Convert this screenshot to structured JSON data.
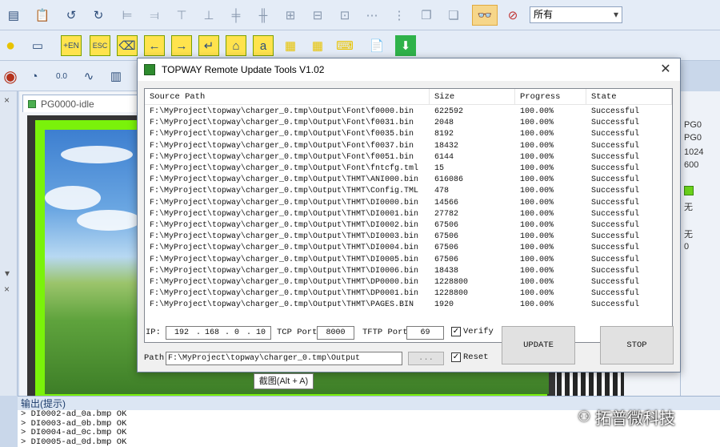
{
  "toolbar3": {
    "preset_label": "所有"
  },
  "doc": {
    "tab_title": "PG0000-idle"
  },
  "properties": [
    "PG0",
    "PG0",
    "1024",
    "600",
    "无",
    "无",
    "0"
  ],
  "dialog": {
    "title": "TOPWAY Remote Update Tools V1.02",
    "columns": [
      "Source Path",
      "Size",
      "Progress",
      "State"
    ],
    "rows": [
      {
        "path": "F:\\MyProject\\topway\\charger_0.tmp\\Output\\Font\\f0000.bin",
        "size": "622592",
        "progress": "100.00%",
        "state": "Successful"
      },
      {
        "path": "F:\\MyProject\\topway\\charger_0.tmp\\Output\\Font\\f0031.bin",
        "size": "2048",
        "progress": "100.00%",
        "state": "Successful"
      },
      {
        "path": "F:\\MyProject\\topway\\charger_0.tmp\\Output\\Font\\f0035.bin",
        "size": "8192",
        "progress": "100.00%",
        "state": "Successful"
      },
      {
        "path": "F:\\MyProject\\topway\\charger_0.tmp\\Output\\Font\\f0037.bin",
        "size": "18432",
        "progress": "100.00%",
        "state": "Successful"
      },
      {
        "path": "F:\\MyProject\\topway\\charger_0.tmp\\Output\\Font\\f0051.bin",
        "size": "6144",
        "progress": "100.00%",
        "state": "Successful"
      },
      {
        "path": "F:\\MyProject\\topway\\charger_0.tmp\\Output\\Font\\fntcfg.tml",
        "size": "15",
        "progress": "100.00%",
        "state": "Successful"
      },
      {
        "path": "F:\\MyProject\\topway\\charger_0.tmp\\Output\\THMT\\ANI000.bin",
        "size": "616086",
        "progress": "100.00%",
        "state": "Successful"
      },
      {
        "path": "F:\\MyProject\\topway\\charger_0.tmp\\Output\\THMT\\Config.TML",
        "size": "478",
        "progress": "100.00%",
        "state": "Successful"
      },
      {
        "path": "F:\\MyProject\\topway\\charger_0.tmp\\Output\\THMT\\DI0000.bin",
        "size": "14566",
        "progress": "100.00%",
        "state": "Successful"
      },
      {
        "path": "F:\\MyProject\\topway\\charger_0.tmp\\Output\\THMT\\DI0001.bin",
        "size": "27782",
        "progress": "100.00%",
        "state": "Successful"
      },
      {
        "path": "F:\\MyProject\\topway\\charger_0.tmp\\Output\\THMT\\DI0002.bin",
        "size": "67506",
        "progress": "100.00%",
        "state": "Successful"
      },
      {
        "path": "F:\\MyProject\\topway\\charger_0.tmp\\Output\\THMT\\DI0003.bin",
        "size": "67506",
        "progress": "100.00%",
        "state": "Successful"
      },
      {
        "path": "F:\\MyProject\\topway\\charger_0.tmp\\Output\\THMT\\DI0004.bin",
        "size": "67506",
        "progress": "100.00%",
        "state": "Successful"
      },
      {
        "path": "F:\\MyProject\\topway\\charger_0.tmp\\Output\\THMT\\DI0005.bin",
        "size": "67506",
        "progress": "100.00%",
        "state": "Successful"
      },
      {
        "path": "F:\\MyProject\\topway\\charger_0.tmp\\Output\\THMT\\DI0006.bin",
        "size": "18438",
        "progress": "100.00%",
        "state": "Successful"
      },
      {
        "path": "F:\\MyProject\\topway\\charger_0.tmp\\Output\\THMT\\DP0000.bin",
        "size": "1228800",
        "progress": "100.00%",
        "state": "Successful"
      },
      {
        "path": "F:\\MyProject\\topway\\charger_0.tmp\\Output\\THMT\\DP0001.bin",
        "size": "1228800",
        "progress": "100.00%",
        "state": "Successful"
      },
      {
        "path": "F:\\MyProject\\topway\\charger_0.tmp\\Output\\THMT\\PAGES.BIN",
        "size": "1920",
        "progress": "100.00%",
        "state": "Successful"
      }
    ],
    "ip_label": "IP:",
    "ip": [
      "192",
      "168",
      "0",
      "10"
    ],
    "tcp_label": "TCP Port:",
    "tcp_port": "8000",
    "tftp_label": "TFTP Port:",
    "tftp_port": "69",
    "verify_label": "Verify",
    "reset_label": "Reset",
    "path_label": "Path:",
    "path_value": "F:\\MyProject\\topway\\charger_0.tmp\\Output",
    "browse_label": "...",
    "update_label": "UPDATE",
    "stop_label": "STOP"
  },
  "tooltip": "截图(Alt + A)",
  "output": {
    "header": "输出(提示)",
    "lines": [
      "> DI0002-ad_0a.bmp   OK",
      "> DI0003-ad_0b.bmp   OK",
      "> DI0004-ad_0c.bmp   OK",
      "> DI0005-ad_0d.bmp   OK"
    ]
  },
  "watermark": "拓普微科技"
}
